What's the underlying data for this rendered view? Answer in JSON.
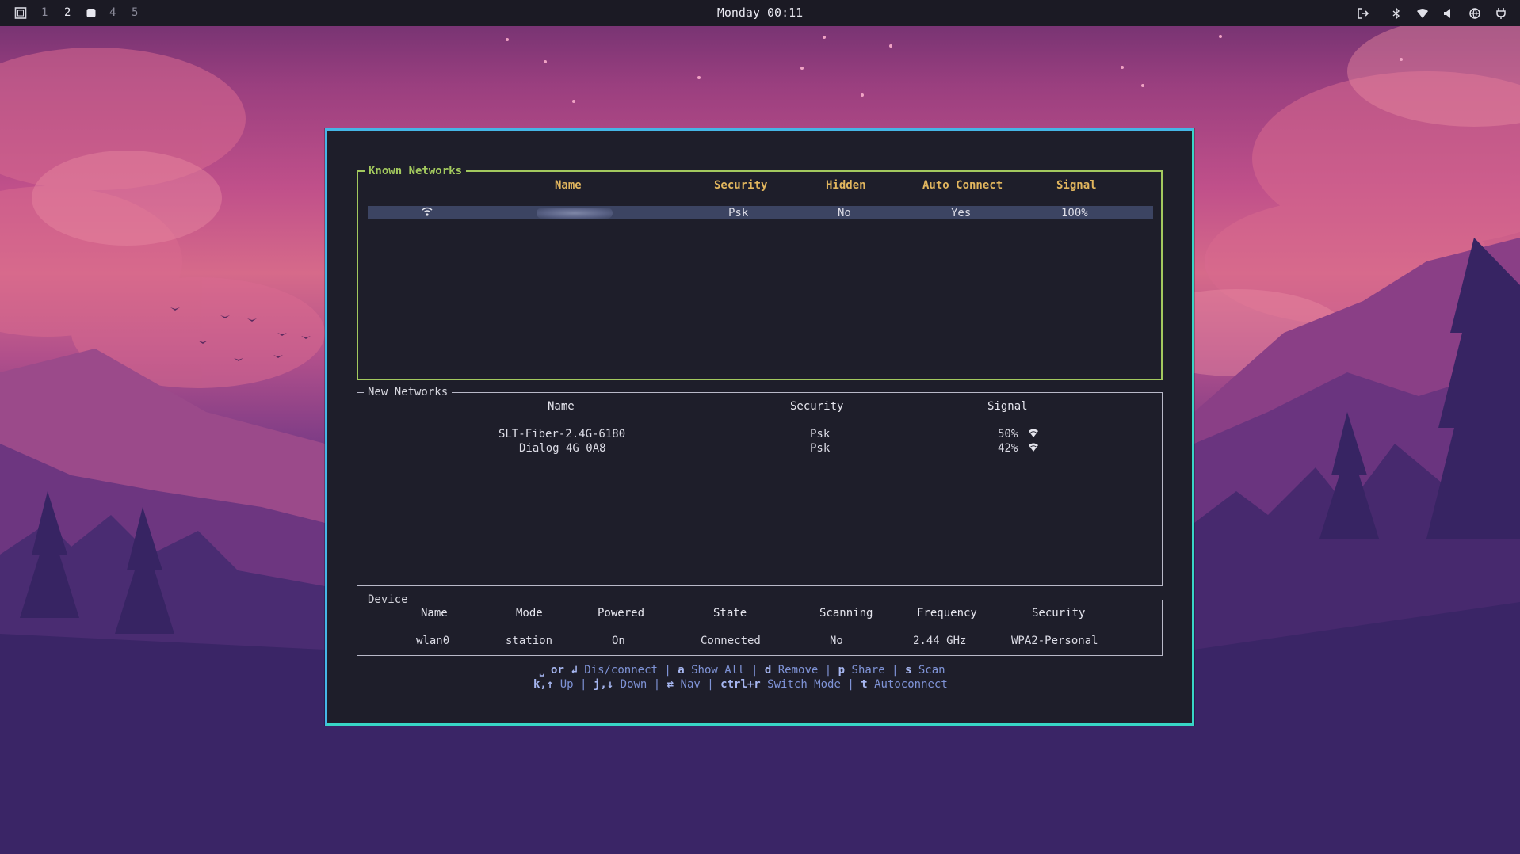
{
  "topbar": {
    "workspaces": [
      "1",
      "2",
      "",
      "4",
      "5"
    ],
    "clock": "Monday 00:11",
    "tray_icons": [
      "logout-icon",
      "bluetooth-icon",
      "wifi-icon",
      "volume-icon",
      "globe-icon",
      "power-icon"
    ]
  },
  "known_networks": {
    "title": "Known Networks",
    "headers": {
      "name": "Name",
      "security": "Security",
      "hidden": "Hidden",
      "auto_connect": "Auto Connect",
      "signal": "Signal"
    },
    "rows": [
      {
        "name": "",
        "security": "Psk",
        "hidden": "No",
        "auto_connect": "Yes",
        "signal": "100%"
      }
    ]
  },
  "new_networks": {
    "title": "New Networks",
    "headers": {
      "name": "Name",
      "security": "Security",
      "signal": "Signal"
    },
    "rows": [
      {
        "name": "SLT-Fiber-2.4G-6180",
        "security": "Psk",
        "signal": "50%"
      },
      {
        "name": "Dialog 4G 0A8",
        "security": "Psk",
        "signal": "42%"
      }
    ]
  },
  "device": {
    "title": "Device",
    "headers": {
      "name": "Name",
      "mode": "Mode",
      "powered": "Powered",
      "state": "State",
      "scanning": "Scanning",
      "frequency": "Frequency",
      "security": "Security"
    },
    "values": {
      "name": "wlan0",
      "mode": "station",
      "powered": "On",
      "state": "Connected",
      "scanning": "No",
      "frequency": "2.44 GHz",
      "security": "WPA2-Personal"
    }
  },
  "help": {
    "line1": [
      {
        "key": "⎵",
        "label": ""
      },
      {
        "key": "or",
        "label": ""
      },
      {
        "key": "↲",
        "label": "Dis/connect"
      },
      {
        "key": "a",
        "label": "Show All"
      },
      {
        "key": "d",
        "label": "Remove"
      },
      {
        "key": "p",
        "label": "Share"
      },
      {
        "key": "s",
        "label": "Scan"
      }
    ],
    "line2": [
      {
        "key": "k,↑",
        "label": "Up"
      },
      {
        "key": "j,↓",
        "label": "Down"
      },
      {
        "key": "⇄",
        "label": "Nav"
      },
      {
        "key": "ctrl+r",
        "label": "Switch Mode"
      },
      {
        "key": "t",
        "label": "Autoconnect"
      }
    ],
    "separator": "|"
  },
  "colors": {
    "known_border": "#a3c95e",
    "window_border": "#38d6c6",
    "header_gold": "#e2b65e",
    "selection": "#3c4462",
    "help_text": "#7f93d6"
  }
}
